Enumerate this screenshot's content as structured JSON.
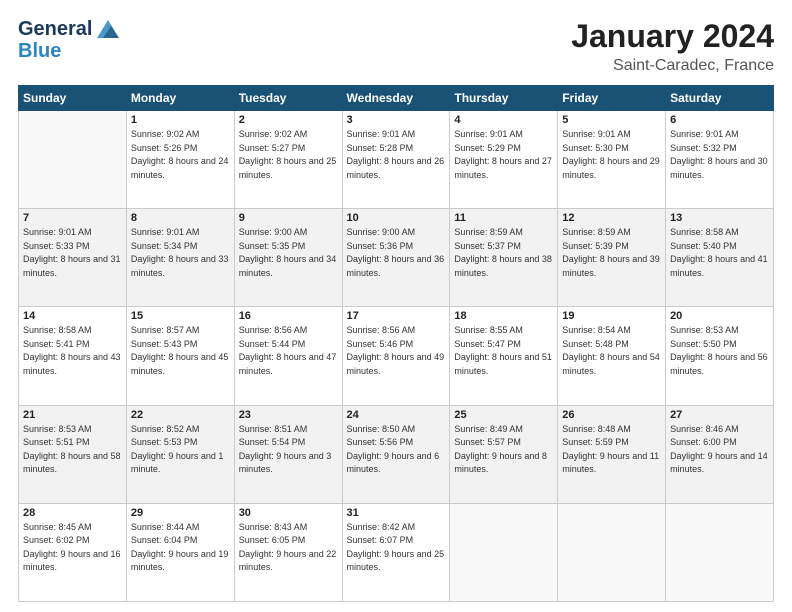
{
  "header": {
    "logo_line1": "General",
    "logo_line2": "Blue",
    "title": "January 2024",
    "subtitle": "Saint-Caradec, France"
  },
  "weekdays": [
    "Sunday",
    "Monday",
    "Tuesday",
    "Wednesday",
    "Thursday",
    "Friday",
    "Saturday"
  ],
  "weeks": [
    [
      {
        "day": "",
        "empty": true
      },
      {
        "day": "1",
        "sunrise": "9:02 AM",
        "sunset": "5:26 PM",
        "daylight": "8 hours and 24 minutes."
      },
      {
        "day": "2",
        "sunrise": "9:02 AM",
        "sunset": "5:27 PM",
        "daylight": "8 hours and 25 minutes."
      },
      {
        "day": "3",
        "sunrise": "9:01 AM",
        "sunset": "5:28 PM",
        "daylight": "8 hours and 26 minutes."
      },
      {
        "day": "4",
        "sunrise": "9:01 AM",
        "sunset": "5:29 PM",
        "daylight": "8 hours and 27 minutes."
      },
      {
        "day": "5",
        "sunrise": "9:01 AM",
        "sunset": "5:30 PM",
        "daylight": "8 hours and 29 minutes."
      },
      {
        "day": "6",
        "sunrise": "9:01 AM",
        "sunset": "5:32 PM",
        "daylight": "8 hours and 30 minutes."
      }
    ],
    [
      {
        "day": "7",
        "sunrise": "9:01 AM",
        "sunset": "5:33 PM",
        "daylight": "8 hours and 31 minutes."
      },
      {
        "day": "8",
        "sunrise": "9:01 AM",
        "sunset": "5:34 PM",
        "daylight": "8 hours and 33 minutes."
      },
      {
        "day": "9",
        "sunrise": "9:00 AM",
        "sunset": "5:35 PM",
        "daylight": "8 hours and 34 minutes."
      },
      {
        "day": "10",
        "sunrise": "9:00 AM",
        "sunset": "5:36 PM",
        "daylight": "8 hours and 36 minutes."
      },
      {
        "day": "11",
        "sunrise": "8:59 AM",
        "sunset": "5:37 PM",
        "daylight": "8 hours and 38 minutes."
      },
      {
        "day": "12",
        "sunrise": "8:59 AM",
        "sunset": "5:39 PM",
        "daylight": "8 hours and 39 minutes."
      },
      {
        "day": "13",
        "sunrise": "8:58 AM",
        "sunset": "5:40 PM",
        "daylight": "8 hours and 41 minutes."
      }
    ],
    [
      {
        "day": "14",
        "sunrise": "8:58 AM",
        "sunset": "5:41 PM",
        "daylight": "8 hours and 43 minutes."
      },
      {
        "day": "15",
        "sunrise": "8:57 AM",
        "sunset": "5:43 PM",
        "daylight": "8 hours and 45 minutes."
      },
      {
        "day": "16",
        "sunrise": "8:56 AM",
        "sunset": "5:44 PM",
        "daylight": "8 hours and 47 minutes."
      },
      {
        "day": "17",
        "sunrise": "8:56 AM",
        "sunset": "5:46 PM",
        "daylight": "8 hours and 49 minutes."
      },
      {
        "day": "18",
        "sunrise": "8:55 AM",
        "sunset": "5:47 PM",
        "daylight": "8 hours and 51 minutes."
      },
      {
        "day": "19",
        "sunrise": "8:54 AM",
        "sunset": "5:48 PM",
        "daylight": "8 hours and 54 minutes."
      },
      {
        "day": "20",
        "sunrise": "8:53 AM",
        "sunset": "5:50 PM",
        "daylight": "8 hours and 56 minutes."
      }
    ],
    [
      {
        "day": "21",
        "sunrise": "8:53 AM",
        "sunset": "5:51 PM",
        "daylight": "8 hours and 58 minutes."
      },
      {
        "day": "22",
        "sunrise": "8:52 AM",
        "sunset": "5:53 PM",
        "daylight": "9 hours and 1 minute."
      },
      {
        "day": "23",
        "sunrise": "8:51 AM",
        "sunset": "5:54 PM",
        "daylight": "9 hours and 3 minutes."
      },
      {
        "day": "24",
        "sunrise": "8:50 AM",
        "sunset": "5:56 PM",
        "daylight": "9 hours and 6 minutes."
      },
      {
        "day": "25",
        "sunrise": "8:49 AM",
        "sunset": "5:57 PM",
        "daylight": "9 hours and 8 minutes."
      },
      {
        "day": "26",
        "sunrise": "8:48 AM",
        "sunset": "5:59 PM",
        "daylight": "9 hours and 11 minutes."
      },
      {
        "day": "27",
        "sunrise": "8:46 AM",
        "sunset": "6:00 PM",
        "daylight": "9 hours and 14 minutes."
      }
    ],
    [
      {
        "day": "28",
        "sunrise": "8:45 AM",
        "sunset": "6:02 PM",
        "daylight": "9 hours and 16 minutes."
      },
      {
        "day": "29",
        "sunrise": "8:44 AM",
        "sunset": "6:04 PM",
        "daylight": "9 hours and 19 minutes."
      },
      {
        "day": "30",
        "sunrise": "8:43 AM",
        "sunset": "6:05 PM",
        "daylight": "9 hours and 22 minutes."
      },
      {
        "day": "31",
        "sunrise": "8:42 AM",
        "sunset": "6:07 PM",
        "daylight": "9 hours and 25 minutes."
      },
      {
        "day": "",
        "empty": true
      },
      {
        "day": "",
        "empty": true
      },
      {
        "day": "",
        "empty": true
      }
    ]
  ],
  "labels": {
    "sunrise": "Sunrise:",
    "sunset": "Sunset:",
    "daylight": "Daylight:"
  }
}
